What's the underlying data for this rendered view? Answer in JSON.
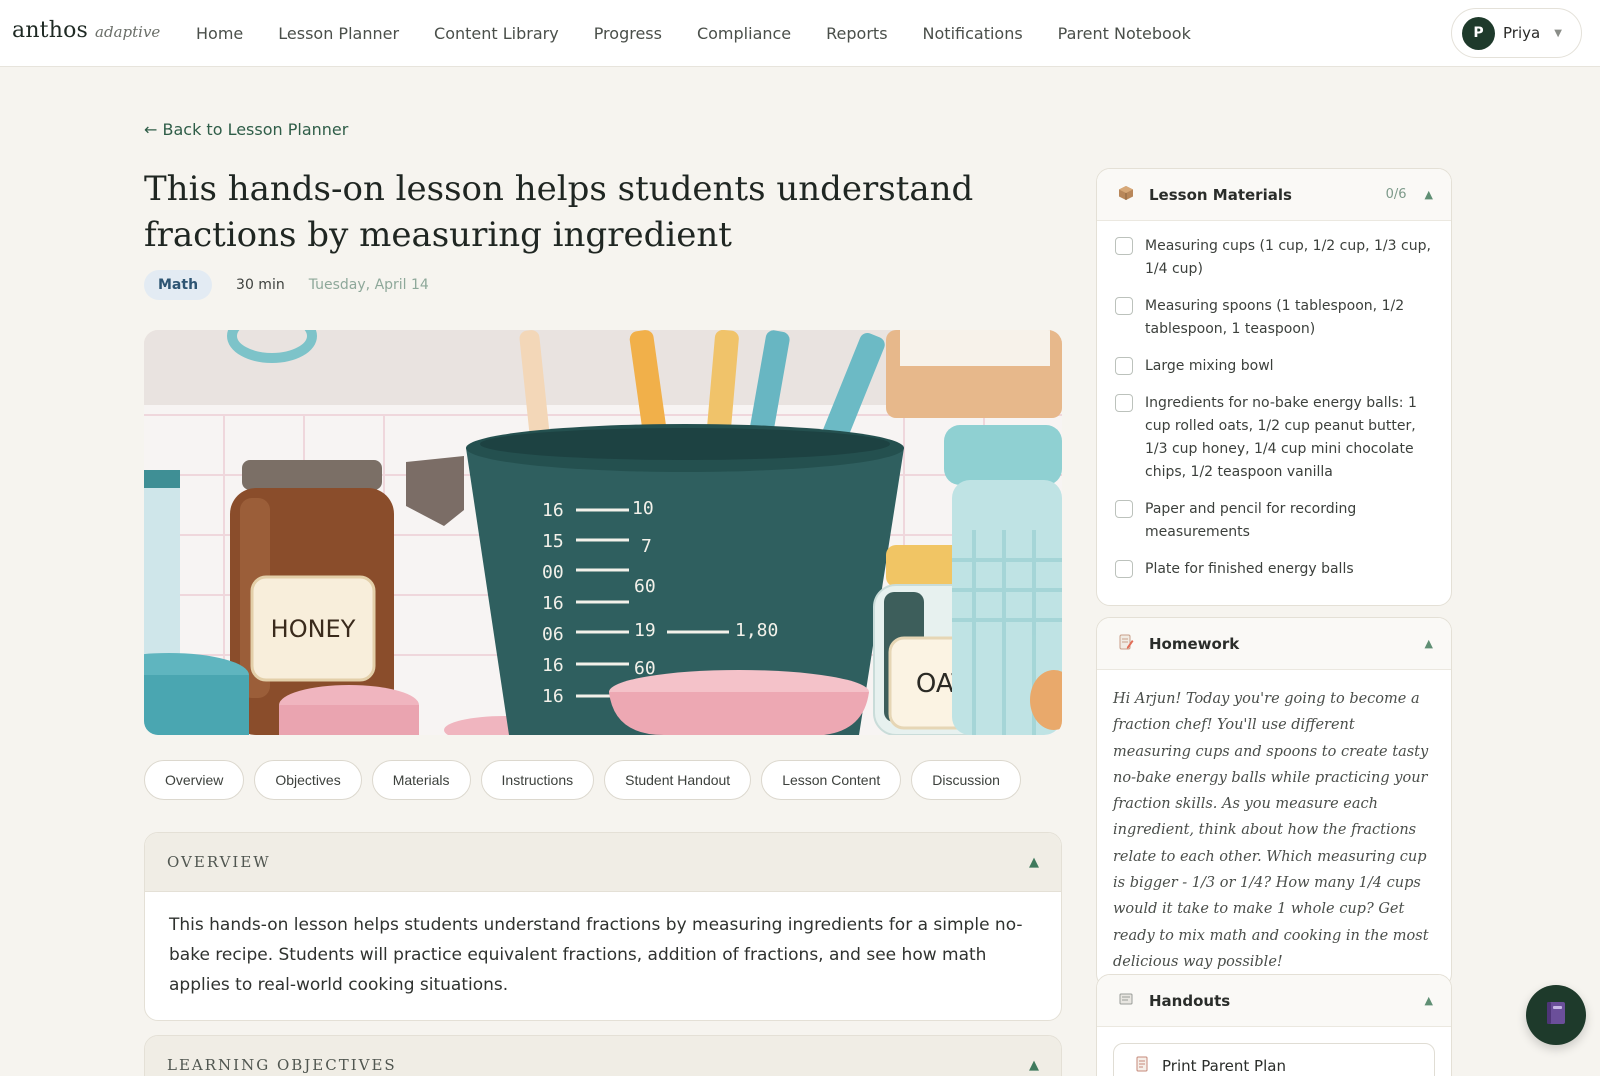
{
  "brand": {
    "name": "anthos",
    "tagline": "adaptive"
  },
  "nav": {
    "links": [
      "Home",
      "Lesson Planner",
      "Content Library",
      "Progress",
      "Compliance",
      "Reports",
      "Notifications",
      "Parent Notebook"
    ]
  },
  "user": {
    "initial": "P",
    "name": "Priya"
  },
  "page": {
    "back_label": "← Back to Lesson Planner",
    "title": "This hands-on lesson helps students understand fractions by measuring ingredient",
    "subject": "Math",
    "duration": "30 min",
    "date": "Tuesday, April 14"
  },
  "hero": {
    "honey_label": "HONEY",
    "oats_label": "OATS",
    "scale_left": [
      "16",
      "15",
      "00",
      "16",
      "06",
      "16",
      "16"
    ],
    "scale_right": [
      "10",
      "7",
      "60",
      "19",
      "60"
    ],
    "scale_extra": "1,80"
  },
  "tabs": [
    "Overview",
    "Objectives",
    "Materials",
    "Instructions",
    "Student Handout",
    "Lesson Content",
    "Discussion"
  ],
  "sections": {
    "overview": {
      "title": "OVERVIEW",
      "body": "This hands-on lesson helps students understand fractions by measuring ingredients for a simple no-bake recipe. Students will practice equivalent fractions, addition of fractions, and see how math applies to real-world cooking situations."
    },
    "objectives": {
      "title": "LEARNING OBJECTIVES"
    }
  },
  "materials": {
    "title": "Lesson Materials",
    "count": "0/6",
    "items": [
      "Measuring cups (1 cup, 1/2 cup, 1/3 cup, 1/4 cup)",
      "Measuring spoons (1 tablespoon, 1/2 tablespoon, 1 teaspoon)",
      "Large mixing bowl",
      "Ingredients for no-bake energy balls: 1 cup rolled oats, 1/2 cup peanut butter, 1/3 cup honey, 1/4 cup mini chocolate chips, 1/2 teaspoon vanilla",
      "Paper and pencil for recording measurements",
      "Plate for finished energy balls"
    ]
  },
  "homework": {
    "title": "Homework",
    "body": "Hi Arjun! Today you're going to become a fraction chef! You'll use different measuring cups and spoons to create tasty no-bake energy balls while practicing your fraction skills. As you measure each ingredient, think about how the fractions relate to each other. Which measuring cup is bigger - 1/3 or 1/4? How many 1/4 cups would it take to make 1 whole cup? Get ready to mix math and cooking in the most delicious way possible!"
  },
  "handouts": {
    "title": "Handouts",
    "print_label": "Print Parent Plan"
  },
  "icons": {
    "materials": "box-icon",
    "homework": "notebook-pencil-icon",
    "handouts": "document-icon",
    "print": "printer-icon",
    "fab": "book-icon"
  },
  "colors": {
    "primary": "#1e3a2b",
    "accent": "#3f7a5d",
    "background": "#f6f4ef"
  }
}
